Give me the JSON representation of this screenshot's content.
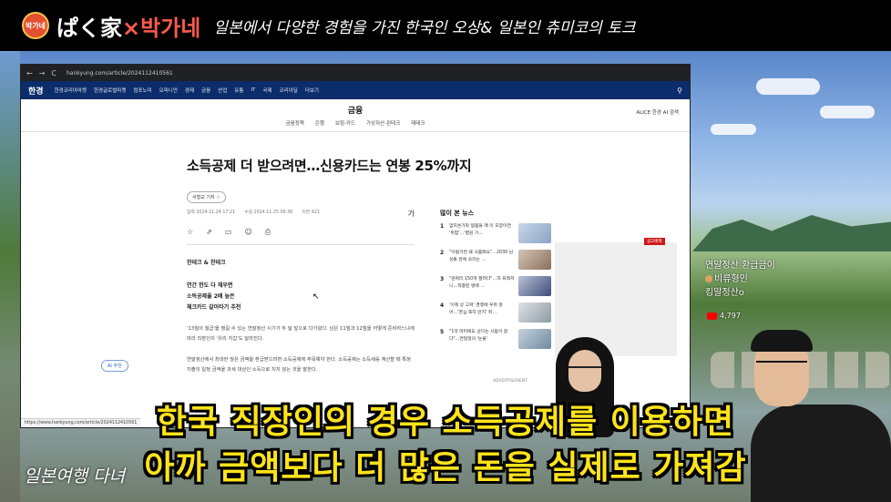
{
  "banner": {
    "logo_text": "박가네",
    "brand_jp": "ぱく家",
    "brand_x": "×",
    "brand_kr": "박가네",
    "subtitle": "일본에서 다양한 경험을 가진 한국인 오상& 일본인 츄미코의 토크"
  },
  "browser": {
    "url": "hankyung.com/article/2024112410561",
    "nav_back": "←",
    "nav_forward": "→",
    "nav_reload": "C",
    "site": {
      "brand": "한경",
      "nav_items": [
        "한경코리아마켓",
        "한경글로벌마켓",
        "컴포노미",
        "오피니언",
        "경제",
        "금융",
        "산업",
        "유통",
        "IT",
        "국제",
        "코리아딜",
        "더보기"
      ],
      "search_icon": "search-icon"
    },
    "section": {
      "title": "금융",
      "tabs": [
        "금융정책",
        "은행",
        "보험·카드",
        "가상자산·핀테크",
        "재테크"
      ],
      "alice": "ALICE 한경 AI 검색"
    },
    "article": {
      "headline": "소득공제 더 받으려면…신용카드는 연봉 25%까지",
      "reporter": "서형교 기자 ☆",
      "meta_input": "입력 2024.11.24 17:21",
      "meta_update": "수정 2024.11.25 06:36",
      "meta_page": "지면 A21",
      "font_size_label": "가",
      "category": "찬테크 & 찬테크",
      "summary": [
        "연간 한도 다 채우면",
        "소득공제율 2배 높은",
        "체크카드 갈아타기 추천"
      ],
      "para1": "'13월의 월급'을 챙길 수 있는 연말정산 시기가 두 달 앞으로 다가왔다. 남은 11월과 12월을 어떻게 준비하느냐에 따라 직장인의 '유리 지갑'도 달라진다.",
      "para2": "연말정산에서 최대한 많은 금액을 환급받으려면 소득공제에 주목해야 한다. 소득공제는 소득세를 계산할 때 특정 지출의 일정 금액을 과세 대상인 소득으로 치지 않는 것을 말한다."
    },
    "ai_button": "AI 추천",
    "popular": {
      "title": "많이 본 뉴스",
      "items": [
        {
          "num": "1",
          "text": "엄지손가락 찜찜을 매 이 모양이면 '위험'…'병원 가…"
        },
        {
          "num": "2",
          "text": "\"이럴거면 왜 사줌래요\"…2030 남성들 완에 쏘리는 …"
        },
        {
          "num": "3",
          "text": "\"원짜리 150개 팔려다\"…하 프레저니…적중된 명배 …"
        },
        {
          "num": "4",
          "text": "'이제 상 고쳐' 경쟁에 우유 헐어…'영심 축하 만치' 취…"
        },
        {
          "num": "5",
          "text": "\"1억 마피에도 산다는 사람이 없다\"…연달정의 '눈물'"
        }
      ]
    },
    "ad_tag": "광고배제",
    "advertisement": "ADVERTISEMENT",
    "status_url": "https://www.hankyung.com/article/2024112410561"
  },
  "live": {
    "line1": "연말정산 환급금이",
    "line2": "비류형인",
    "line3": "킹말정산o",
    "views": "4,797"
  },
  "subtitles": {
    "line1": "한국 직장인의 경우 소득공제를 이용하면",
    "line2": "아까 금액보다 더 많은 돈을 실제로 가져감"
  },
  "bottom_caption": "일본여행 다녀"
}
